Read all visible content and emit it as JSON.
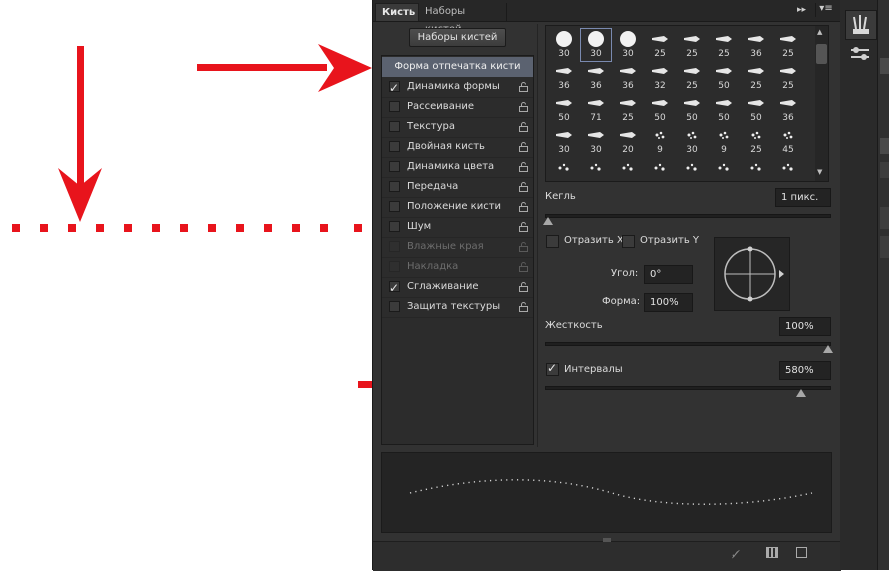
{
  "tabs": {
    "brush": "Кисть",
    "brush_presets": "Наборы кистей"
  },
  "presets_button": "Наборы кистей",
  "brush_tip_shape": "Форма отпечатка кисти",
  "sections": [
    {
      "label": "Динамика формы",
      "checked": true,
      "enabled": true
    },
    {
      "label": "Рассеивание",
      "checked": false,
      "enabled": true
    },
    {
      "label": "Текстура",
      "checked": false,
      "enabled": true
    },
    {
      "label": "Двойная кисть",
      "checked": false,
      "enabled": true
    },
    {
      "label": "Динамика цвета",
      "checked": false,
      "enabled": true
    },
    {
      "label": "Передача",
      "checked": false,
      "enabled": true
    },
    {
      "label": "Положение кисти",
      "checked": false,
      "enabled": true
    },
    {
      "label": "Шум",
      "checked": false,
      "enabled": true
    },
    {
      "label": "Влажные края",
      "checked": false,
      "enabled": false
    },
    {
      "label": "Накладка",
      "checked": false,
      "enabled": false
    },
    {
      "label": "Сглаживание",
      "checked": true,
      "enabled": true
    },
    {
      "label": "Защита текстуры",
      "checked": false,
      "enabled": true
    }
  ],
  "brush_rows": [
    [
      "30",
      "30",
      "30",
      "25",
      "25",
      "25",
      "36",
      "25"
    ],
    [
      "36",
      "36",
      "36",
      "32",
      "25",
      "50",
      "25",
      "25"
    ],
    [
      "50",
      "71",
      "25",
      "50",
      "50",
      "50",
      "50",
      "36"
    ],
    [
      "30",
      "30",
      "20",
      "9",
      "30",
      "9",
      "25",
      "45"
    ],
    [
      "",
      "",
      "",
      "",
      "",
      "",
      "",
      ""
    ]
  ],
  "selected_brush": "30",
  "size": {
    "label": "Кегль",
    "value": "1 пикс."
  },
  "flip_x": {
    "label": "Отразить X",
    "checked": false
  },
  "flip_y": {
    "label": "Отразить Y",
    "checked": false
  },
  "angle": {
    "label": "Угол:",
    "value": "0°"
  },
  "roundness": {
    "label": "Форма:",
    "value": "100%"
  },
  "hardness": {
    "label": "Жесткость",
    "value": "100%"
  },
  "spacing": {
    "label": "Интервалы",
    "value": "580%",
    "checked": true
  },
  "slider_levels": {
    "size": 0.0,
    "hardness": 1.0,
    "spacing": 0.905
  },
  "colors": {
    "annotation_red": "#e8141c",
    "panel_bg": "#323232",
    "selected_item": "#5b6270"
  }
}
